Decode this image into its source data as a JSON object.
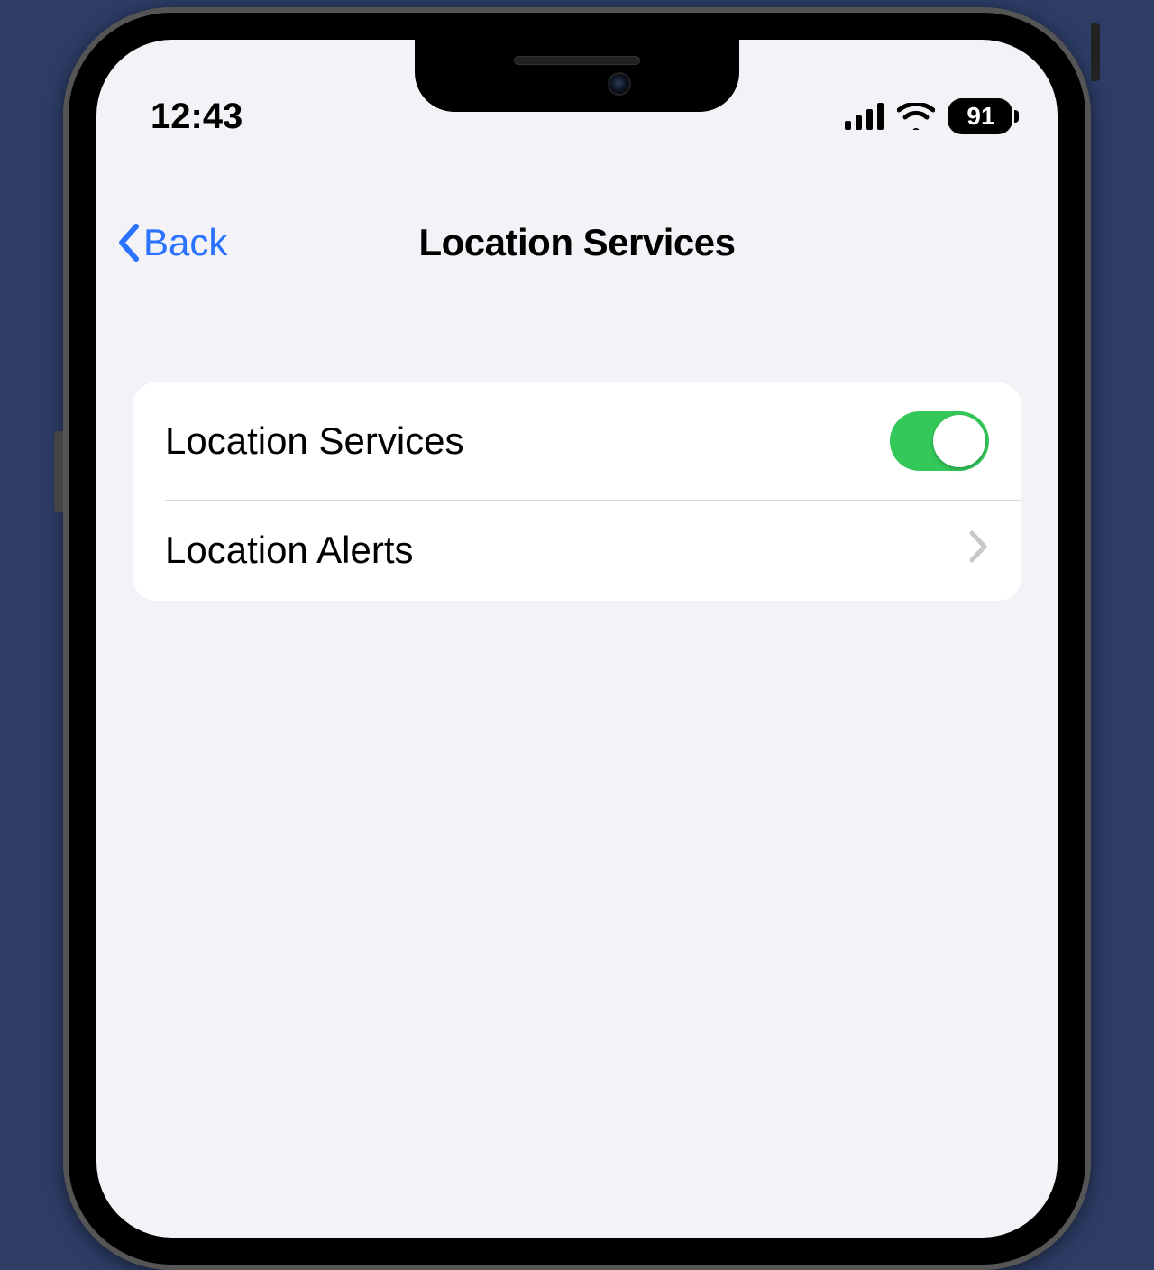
{
  "status": {
    "time": "12:43",
    "battery": "91"
  },
  "nav": {
    "back_label": "Back",
    "title": "Location Services"
  },
  "rows": [
    {
      "label": "Location Services",
      "type": "toggle",
      "on": true
    },
    {
      "label": "Location Alerts",
      "type": "nav"
    }
  ],
  "colors": {
    "accent": "#2a72ff",
    "toggle_on": "#34c759"
  }
}
